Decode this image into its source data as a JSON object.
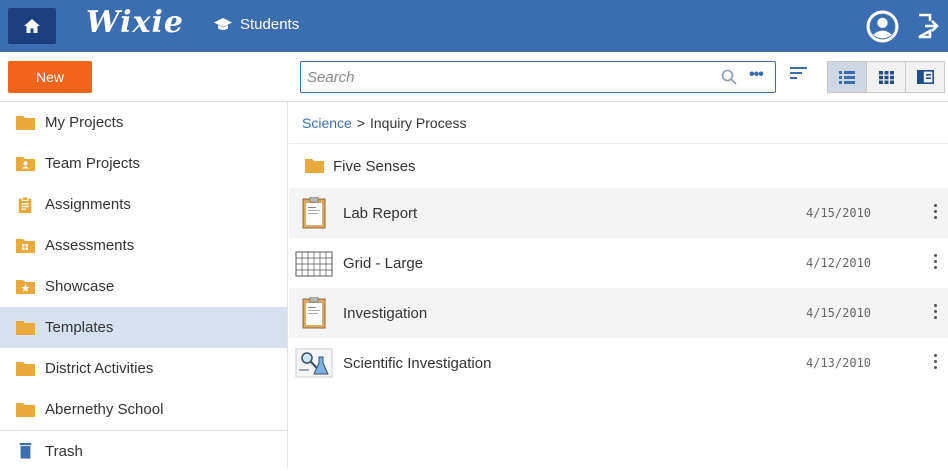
{
  "header": {
    "logo_text": "Wixie",
    "students_label": "Students",
    "brand_color": "#3b6db1",
    "icons": [
      "home-icon",
      "graduation-cap-icon",
      "account-icon",
      "logout-icon"
    ]
  },
  "toolbar": {
    "new_label": "New",
    "new_color": "#f0641c",
    "search_placeholder": "Search",
    "search_more": "•••",
    "view_modes": [
      "list",
      "grid",
      "detail"
    ],
    "active_view": "list"
  },
  "sidebar": {
    "items": [
      {
        "label": "My Projects",
        "icon": "folder-icon"
      },
      {
        "label": "Team Projects",
        "icon": "team-folder-icon"
      },
      {
        "label": "Assignments",
        "icon": "clipboard-icon"
      },
      {
        "label": "Assessments",
        "icon": "assessment-folder-icon"
      },
      {
        "label": "Showcase",
        "icon": "star-folder-icon"
      },
      {
        "label": "Templates",
        "icon": "folder-icon",
        "active": true
      },
      {
        "label": "District Activities",
        "icon": "folder-icon"
      },
      {
        "label": "Abernethy School",
        "icon": "folder-icon"
      }
    ],
    "trash_label": "Trash"
  },
  "main": {
    "breadcrumb": {
      "parent": "Science",
      "separator": ">",
      "current": "Inquiry Process"
    },
    "folder": {
      "name": "Five Senses"
    },
    "files": [
      {
        "name": "Lab Report",
        "date": "4/15/2010",
        "thumb": "clipboard-document"
      },
      {
        "name": "Grid - Large",
        "date": "4/12/2010",
        "thumb": "grid"
      },
      {
        "name": "Investigation",
        "date": "4/15/2010",
        "thumb": "clipboard-document"
      },
      {
        "name": "Scientific Investigation",
        "date": "4/13/2010",
        "thumb": "science-image"
      }
    ]
  }
}
